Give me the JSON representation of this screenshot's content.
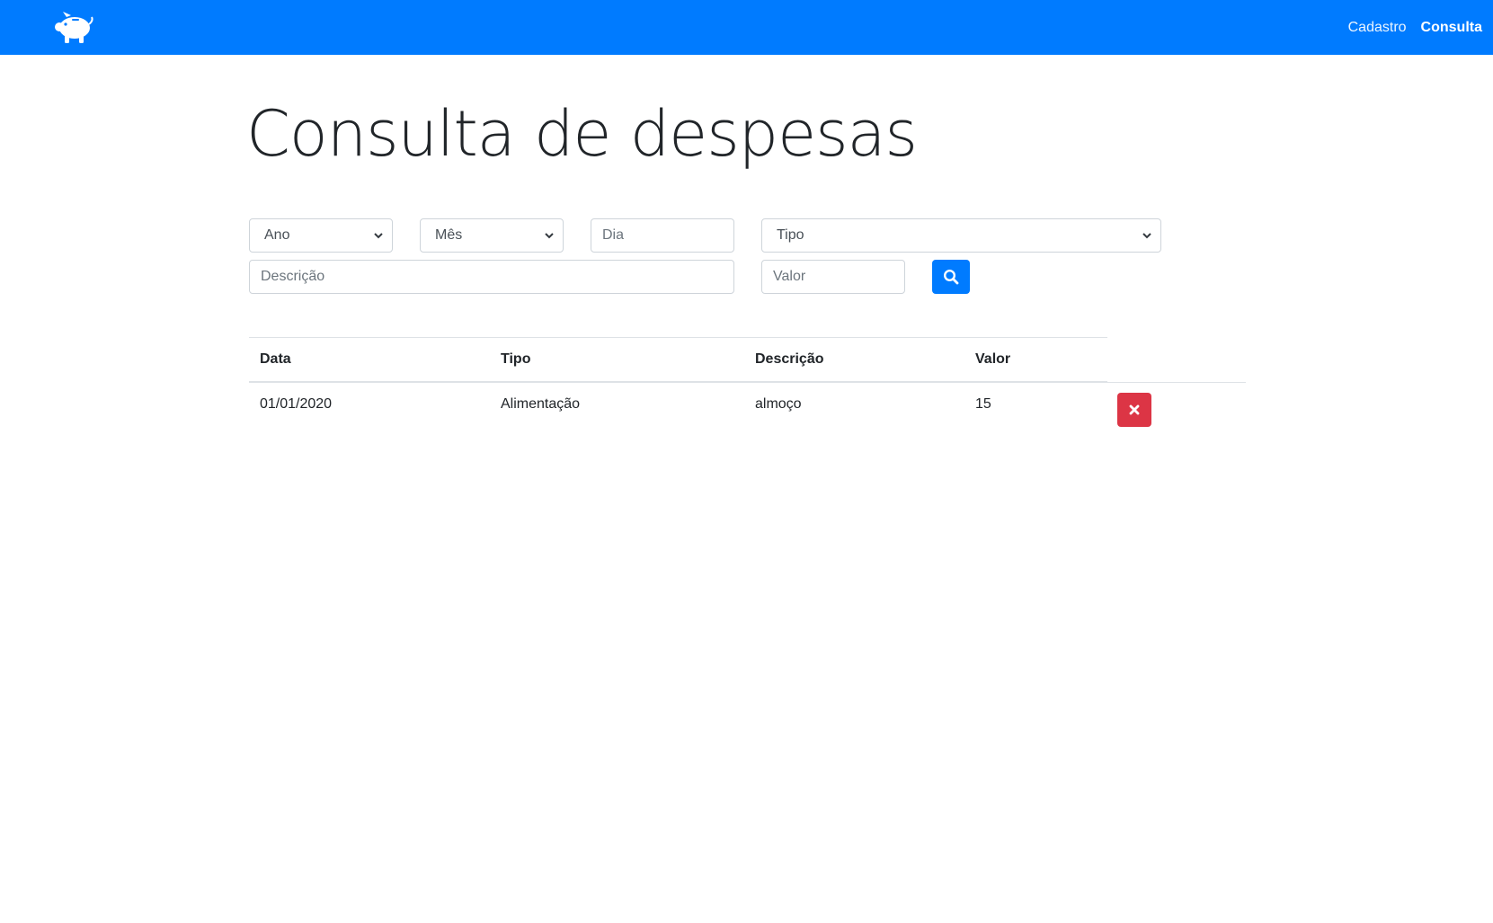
{
  "navbar": {
    "logo_icon": "piggy-bank-icon",
    "links": [
      {
        "label": "Cadastro",
        "active": false
      },
      {
        "label": "Consulta",
        "active": true
      }
    ],
    "color": "#007bff"
  },
  "page": {
    "title": "Consulta de despesas"
  },
  "filters": {
    "ano": {
      "selected": "Ano"
    },
    "mes": {
      "selected": "Mês"
    },
    "dia": {
      "placeholder": "Dia"
    },
    "tipo": {
      "selected": "Tipo"
    },
    "descricao": {
      "placeholder": "Descrição"
    },
    "valor": {
      "placeholder": "Valor"
    },
    "search_icon": "search-icon",
    "search_color": "#007bff"
  },
  "table": {
    "headers": [
      "Data",
      "Tipo",
      "Descrição",
      "Valor"
    ],
    "rows": [
      {
        "data": "01/01/2020",
        "tipo": "Alimentação",
        "descricao": "almoço",
        "valor": "15"
      }
    ],
    "delete_icon": "close-icon",
    "delete_color": "#dc3545"
  }
}
